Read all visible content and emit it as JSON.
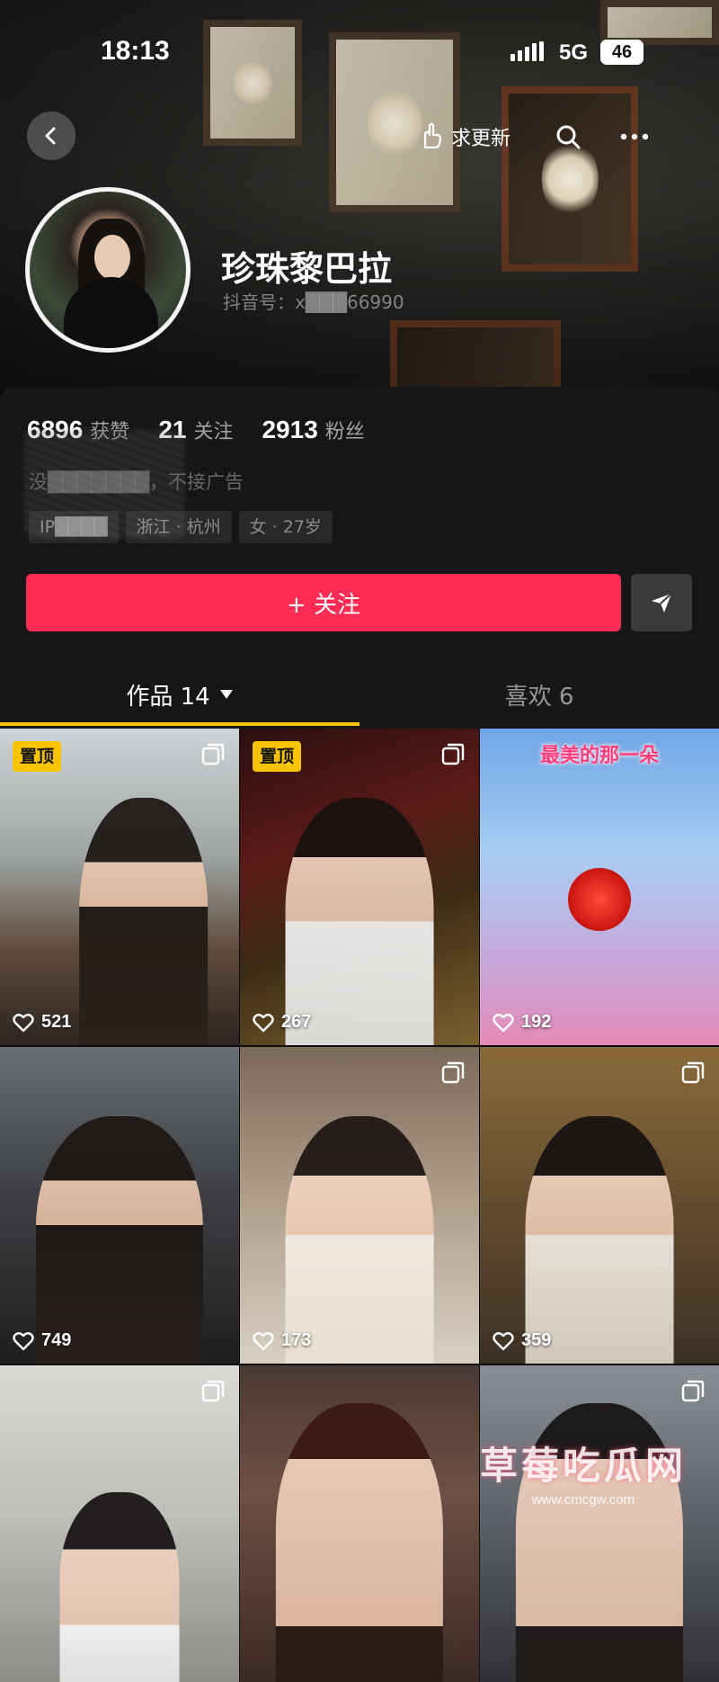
{
  "status_bar": {
    "time": "18:13",
    "network": "5G",
    "battery": "46"
  },
  "header": {
    "update_label": "求更新",
    "nickname": "珍珠黎巴拉",
    "douyin_id": "抖音号：x███66990"
  },
  "profile": {
    "stats": [
      {
        "value": "6896",
        "label": "获赞"
      },
      {
        "value": "21",
        "label": "关注"
      },
      {
        "value": "2913",
        "label": "粉丝"
      }
    ],
    "bio": "没███████，不接广告",
    "tags": [
      "IP████",
      "浙江 · 杭州",
      "女 · 27岁"
    ],
    "follow_label": "+ 关注"
  },
  "tabs": {
    "works_label": "作品 14",
    "likes_label": "喜欢 6"
  },
  "grid": {
    "pin_label": "置顶",
    "items": [
      {
        "likes": "521",
        "pinned": true,
        "multi": true
      },
      {
        "likes": "267",
        "pinned": true,
        "multi": true
      },
      {
        "likes": "192",
        "pinned": false,
        "multi": false,
        "title": "最美的那一朵"
      },
      {
        "likes": "749",
        "pinned": false,
        "multi": false
      },
      {
        "likes": "173",
        "pinned": false,
        "multi": true
      },
      {
        "likes": "359",
        "pinned": false,
        "multi": true
      },
      {
        "likes": "",
        "pinned": false,
        "multi": true
      },
      {
        "likes": "",
        "pinned": false,
        "multi": false
      },
      {
        "likes": "",
        "pinned": false,
        "multi": true
      }
    ]
  },
  "watermark": {
    "title": "草莓吃瓜网",
    "url": "www.cmcgw.com"
  },
  "colors": {
    "accent": "#fe2c55",
    "tab_underline": "#f8c300",
    "pin_badge": "#f8c300",
    "background": "#161618"
  },
  "icons": [
    "back-icon",
    "hand-point-icon",
    "search-icon",
    "more-icon",
    "share-arrow-icon",
    "heart-icon",
    "multi-photo-icon",
    "dropdown-triangle-icon"
  ]
}
